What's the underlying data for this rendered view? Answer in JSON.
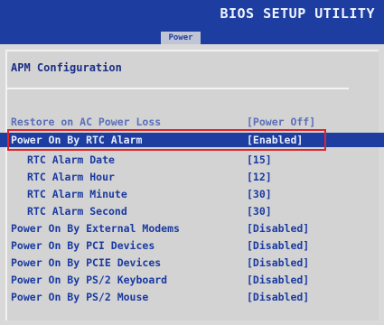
{
  "header": {
    "app_title": "BIOS SETUP UTILITY",
    "active_tab": "Power"
  },
  "section": {
    "title": "APM Configuration"
  },
  "settings": [
    {
      "label": "Restore on AC Power Loss",
      "value": "[Power Off]"
    },
    {
      "label": "Power On By RTC Alarm",
      "value": "[Enabled]"
    },
    {
      "label": "RTC Alarm Date",
      "value": "[15]"
    },
    {
      "label": "RTC Alarm Hour",
      "value": "[12]"
    },
    {
      "label": "RTC Alarm Minute",
      "value": "[30]"
    },
    {
      "label": "RTC Alarm Second",
      "value": "[30]"
    },
    {
      "label": "Power On By External Modems",
      "value": "[Disabled]"
    },
    {
      "label": "Power On By PCI Devices",
      "value": "[Disabled]"
    },
    {
      "label": "Power On By PCIE Devices",
      "value": "[Disabled]"
    },
    {
      "label": "Power On By PS/2 Keyboard",
      "value": "[Disabled]"
    },
    {
      "label": "Power On By PS/2 Mouse",
      "value": "[Disabled]"
    }
  ],
  "colors": {
    "header_bg": "#1d3ea0",
    "text_blue": "#1a3aa0",
    "selected_bg": "#1d3ea0",
    "highlight_frame": "#e0242a",
    "panel_bg": "#d3d3d3"
  }
}
